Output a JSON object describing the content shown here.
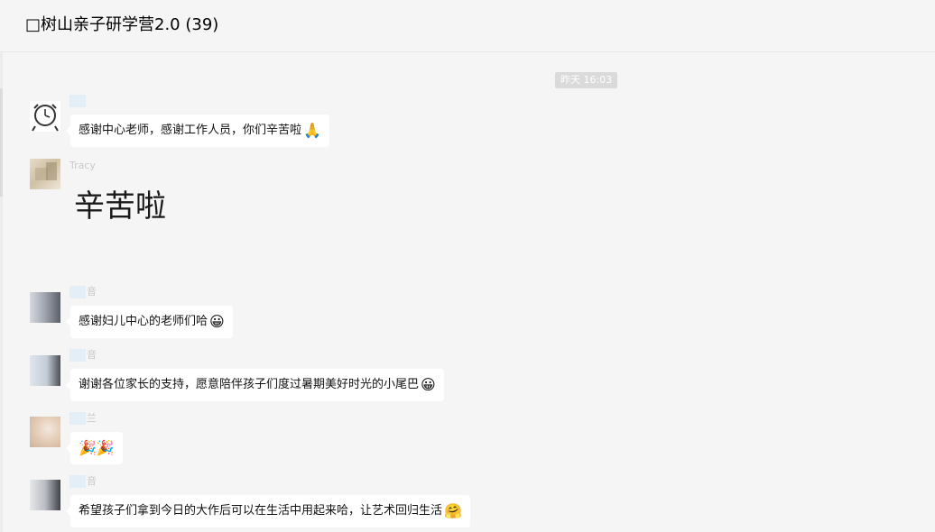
{
  "header": {
    "title": "□树山亲子研学营2.0 (39)"
  },
  "timestamp": "昨天 16:03",
  "messages": [
    {
      "sender": "",
      "text": "感谢中心老师，感谢工作人员，你们辛苦啦",
      "emoji": "🙏",
      "avatar_icon": "clock-avatar-icon"
    },
    {
      "sender": "Tracy",
      "sticker_text": "辛苦啦",
      "avatar_icon": "photo-avatar-icon"
    },
    {
      "sender": "音",
      "text": "感谢妇儿中心的老师们哈",
      "emoji": "😀",
      "avatar_icon": "photo-avatar-icon"
    },
    {
      "sender": "音",
      "text": "谢谢各位家长的支持，愿意陪伴孩子们度过暑期美好时光的小尾巴",
      "emoji": "😀",
      "avatar_icon": "photo-avatar-icon"
    },
    {
      "sender": "兰",
      "text": "",
      "emoji": "🎉🎉",
      "avatar_icon": "photo-avatar-icon"
    },
    {
      "sender": "音",
      "text": "希望孩子们拿到今日的大作后可以在生活中用起来哈，让艺术回归生活",
      "emoji": "🤗",
      "avatar_icon": "photo-avatar-icon"
    }
  ],
  "colors": {
    "background": "#f5f5f5",
    "bubble": "#ffffff",
    "timestamp_bg": "#dadada"
  }
}
